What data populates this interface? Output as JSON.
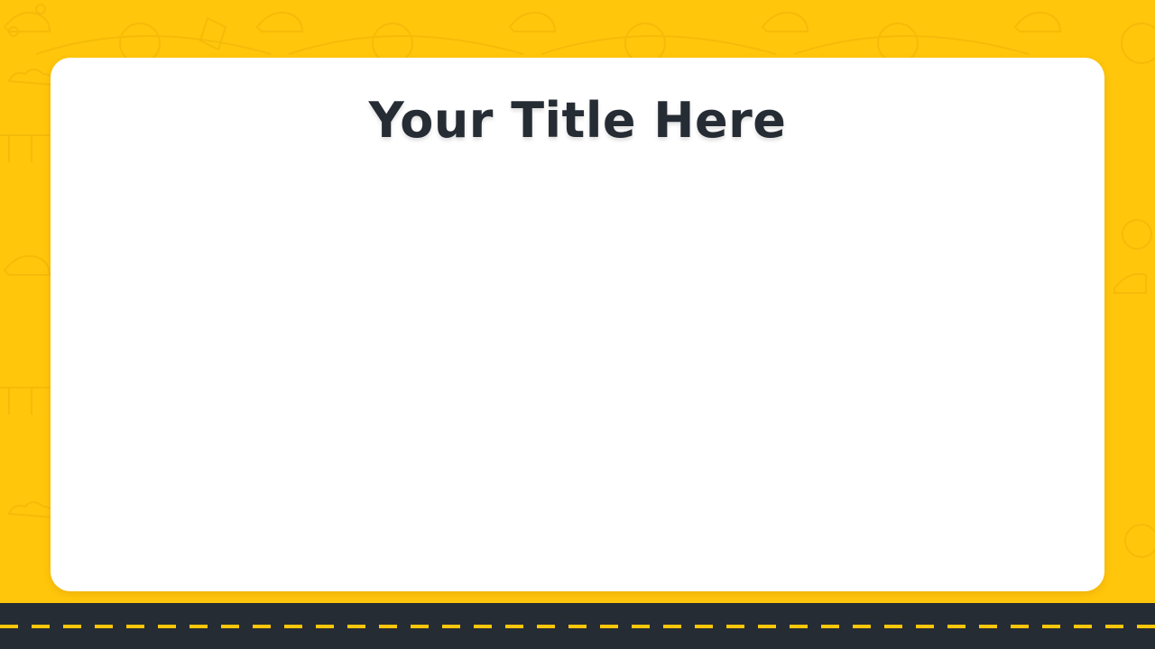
{
  "slide": {
    "title": "Your Title Here",
    "background_color": "#ffc60b",
    "text_color": "#262c34",
    "road_color": "#262c34",
    "road_marking_color": "#ffc60b",
    "pattern_icons": [
      "car-icon",
      "globe-icon",
      "map-icon",
      "bridge-icon",
      "cloud-icon",
      "compass-icon"
    ]
  }
}
